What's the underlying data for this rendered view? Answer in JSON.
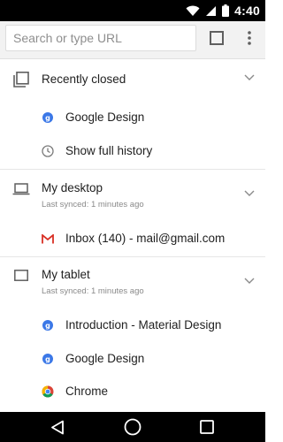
{
  "status_bar": {
    "time": "4:40"
  },
  "toolbar": {
    "search_placeholder": "Search or type URL"
  },
  "sections": [
    {
      "title": "Recently closed",
      "subtitle": "",
      "items": [
        {
          "label": "Google Design",
          "icon": "google-favicon-icon"
        },
        {
          "label": "Show full history",
          "icon": "history-clock-icon"
        }
      ]
    },
    {
      "title": "My desktop",
      "subtitle": "Last synced: 1 minutes ago",
      "items": [
        {
          "label": "Inbox (140) - mail@gmail.com",
          "icon": "gmail-icon"
        }
      ]
    },
    {
      "title": "My tablet",
      "subtitle": "Last synced: 1 minutes ago",
      "items": [
        {
          "label": "Introduction - Material Design",
          "icon": "google-favicon-icon"
        },
        {
          "label": "Google Design",
          "icon": "google-favicon-icon"
        },
        {
          "label": "Chrome",
          "icon": "chrome-icon"
        }
      ]
    }
  ],
  "favicon_letter": "g",
  "colors": {
    "accent_blue": "#3b78e7",
    "gmail_red": "#d93025",
    "status_bar": "#000000",
    "toolbar_bg": "#f2f2f2"
  }
}
